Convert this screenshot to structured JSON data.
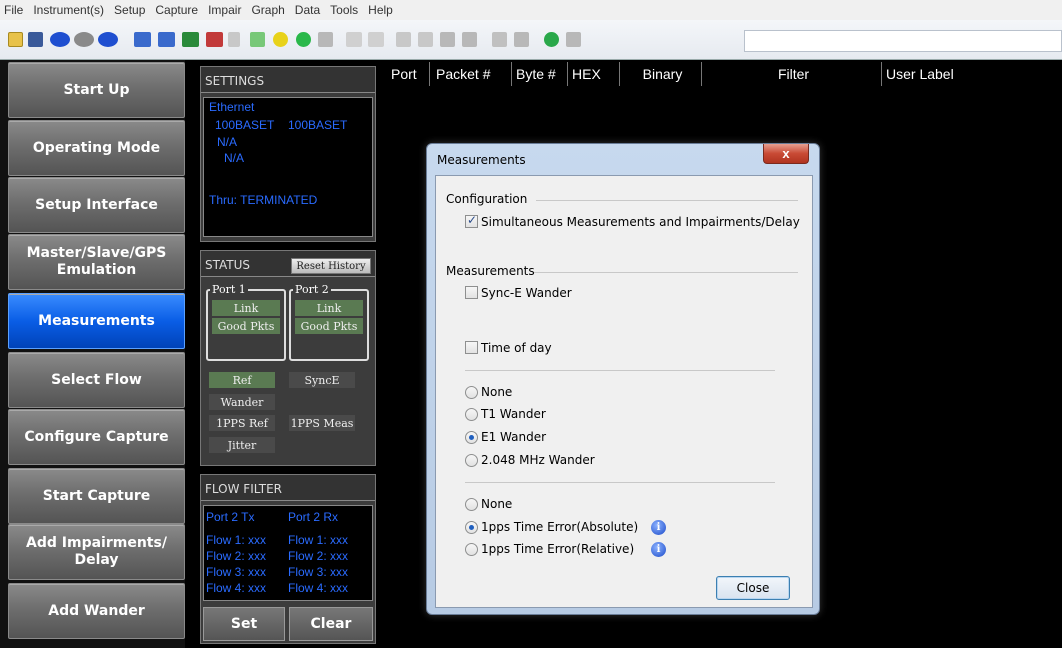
{
  "menu": [
    "File",
    "Instrument(s)",
    "Setup",
    "Capture",
    "Impair",
    "Graph",
    "Data",
    "Tools",
    "Help"
  ],
  "nav": {
    "items": [
      {
        "label": "Start Up",
        "active": false
      },
      {
        "label": "Operating Mode",
        "active": false
      },
      {
        "label": "Setup Interface",
        "active": false
      },
      {
        "label": "Master/Slave/GPS Emulation",
        "active": false
      },
      {
        "label": "Measurements",
        "active": true
      },
      {
        "label": "Select Flow",
        "active": false
      },
      {
        "label": "Configure Capture",
        "active": false
      },
      {
        "label": "Start Capture",
        "active": false
      },
      {
        "label": "Add Impairments/ Delay",
        "active": false
      },
      {
        "label": "Add Wander",
        "active": false
      }
    ]
  },
  "settings": {
    "title": "SETTINGS",
    "ethernet": "Ethernet",
    "port1_mode": "100BASET",
    "port2_mode": "100BASET",
    "na1": "N/A",
    "na2": "N/A",
    "thru": "Thru: TERMINATED"
  },
  "status": {
    "title": "STATUS",
    "reset": "Reset History",
    "port1": "Port 1",
    "port2": "Port 2",
    "link": "Link",
    "good": "Good Pkts",
    "ref": "Ref",
    "synce": "SyncE",
    "wander": "Wander",
    "pps_ref": "1PPS Ref",
    "pps_meas": "1PPS Meas",
    "jitter": "Jitter"
  },
  "flow_filter": {
    "title": "FLOW FILTER",
    "tx_header": "Port 2 Tx",
    "rx_header": "Port 2 Rx",
    "tx": [
      "Flow 1: xxx",
      "Flow 2: xxx",
      "Flow 3: xxx",
      "Flow 4: xxx"
    ],
    "rx": [
      "Flow 1: xxx",
      "Flow 2: xxx",
      "Flow 3: xxx",
      "Flow 4: xxx"
    ],
    "set": "Set",
    "clear": "Clear"
  },
  "columns": [
    "Port",
    "Packet #",
    "Byte #",
    "HEX",
    "Binary",
    "Filter",
    "User Label"
  ],
  "dialog": {
    "title": "Measurements",
    "close_x": "x",
    "config_group": "Configuration",
    "simultaneous": "Simultaneous Measurements and Impairments/Delay",
    "simultaneous_checked": true,
    "meas_group": "Measurements",
    "synce_wander": "Sync-E Wander",
    "time_of_day": "Time of day",
    "wander_options": [
      {
        "label": "None",
        "selected": false
      },
      {
        "label": "T1 Wander",
        "selected": false
      },
      {
        "label": "E1 Wander",
        "selected": true
      },
      {
        "label": "2.048 MHz Wander",
        "selected": false
      }
    ],
    "pps_options": [
      {
        "label": "None",
        "selected": false
      },
      {
        "label": "1pps Time Error(Absolute)",
        "selected": true
      },
      {
        "label": "1pps Time Error(Relative)",
        "selected": false
      }
    ],
    "info_glyph": "i",
    "close_button": "Close"
  }
}
